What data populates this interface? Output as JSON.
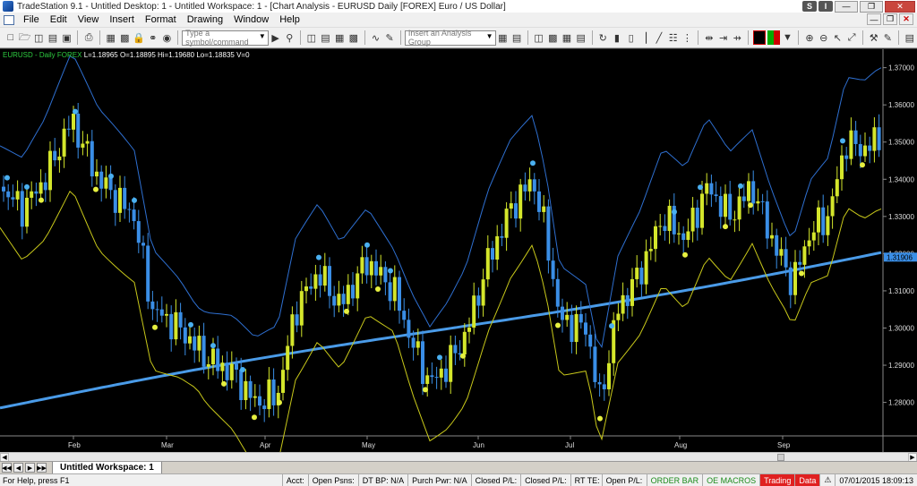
{
  "window": {
    "title": "TradeStation 9.1 - Untitled Desktop: 1 - Untitled Workspace: 1 - [Chart Analysis - EURUSD Daily [FOREX] Euro / US Dollar]",
    "s_button": "S",
    "i_button": "I"
  },
  "menu": {
    "items": [
      "File",
      "Edit",
      "View",
      "Insert",
      "Format",
      "Drawing",
      "Window",
      "Help"
    ]
  },
  "toolbar": {
    "symbol_placeholder": "Type a symbol/command",
    "analysis_group": "Insert an Analysis Group"
  },
  "chart": {
    "header_symbol": "EURUSD - Daily  FOREX",
    "header_values": "L=1.18965  O=1.18895  Hi=1.19680  Lo=1.18835  V=0",
    "price_labels": [
      "1.37000",
      "1.36000",
      "1.35000",
      "1.34000",
      "1.33000",
      "1.32000",
      "1.31000",
      "1.30000",
      "1.29000",
      "1.28000"
    ],
    "last_price_label": "1.31906",
    "month_labels": [
      "Feb",
      "Mar",
      "Apr",
      "May",
      "Jun",
      "Jul",
      "Aug",
      "Sep"
    ],
    "colors": {
      "up_candle": "#d4e62b",
      "down_candle": "#3a8ee6",
      "ma_line": "#4a9be8",
      "upper_band": "#2e6fd0",
      "lower_band": "#c8c81a",
      "pivot_high_dot": "#4ab0f0",
      "pivot_low_dot": "#e6f040"
    }
  },
  "tabs": {
    "workspace": "Untitled Workspace: 1"
  },
  "status": {
    "help": "For Help, press F1",
    "acct": "Acct:",
    "open_psns": "Open Psns:",
    "dt_bp": "DT BP: N/A",
    "purch_pwr": "Purch Pwr: N/A",
    "closed_pl": "Closed P/L:",
    "closed_pl2": "Closed P/L:",
    "rt_te": "RT TE:",
    "open_pl": "Open P/L:",
    "order_bar": "ORDER BAR",
    "oe_macros": "OE MACROS",
    "trading": "Trading",
    "data": "Data",
    "datetime": "07/01/2015 18:09:13"
  }
}
